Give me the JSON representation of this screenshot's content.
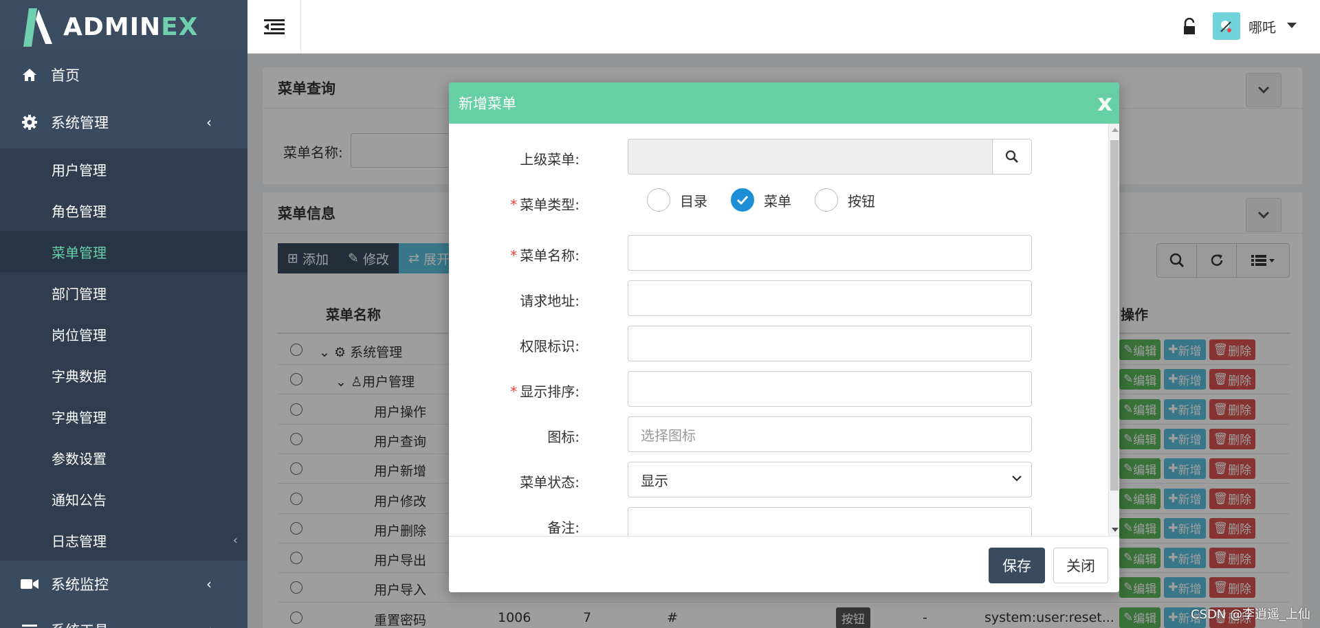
{
  "brand": {
    "logo_main": "ADMIN",
    "logo_accent": "EX"
  },
  "sidebar": {
    "items": [
      {
        "label": "首页",
        "icon": "home-icon"
      },
      {
        "label": "系统管理",
        "icon": "gear-icon"
      },
      {
        "label": "系统监控",
        "icon": "video-icon"
      },
      {
        "label": "系统工具",
        "icon": "bars-icon"
      }
    ],
    "sub_items": [
      "用户管理",
      "角色管理",
      "菜单管理",
      "部门管理",
      "岗位管理",
      "字典数据",
      "字典管理",
      "参数设置",
      "通知公告",
      "日志管理"
    ],
    "active_sub": "菜单管理"
  },
  "topbar": {
    "username": "哪吒"
  },
  "query_panel": {
    "title": "菜单查询",
    "search_label": "菜单名称:"
  },
  "info_panel": {
    "title": "菜单信息",
    "toolbar": {
      "add": "添加",
      "edit": "修改",
      "expand": "展开"
    },
    "columns": {
      "name": "菜单名称",
      "ops": "操作"
    },
    "rows": [
      {
        "name": "系统管理"
      },
      {
        "name": "用户管理"
      },
      {
        "name": "用户操作"
      },
      {
        "name": "用户查询"
      },
      {
        "name": "用户新增"
      },
      {
        "name": "用户修改"
      },
      {
        "name": "用户删除"
      },
      {
        "name": "用户导出"
      },
      {
        "name": "用户导入"
      },
      {
        "name": "重置密码",
        "id": "1006",
        "order": "7",
        "url": "#",
        "type": "按钮",
        "visible": "-",
        "perm": "system:user:reset..."
      }
    ],
    "op_labels": {
      "edit": "编辑",
      "add": "新增",
      "del": "删除"
    }
  },
  "modal": {
    "title": "新增菜单",
    "close_glyph": "x",
    "fields": {
      "parent_label": "上级菜单:",
      "type_label": "菜单类型:",
      "type_options": [
        "目录",
        "菜单",
        "按钮"
      ],
      "type_selected": "菜单",
      "name_label": "菜单名称:",
      "url_label": "请求地址:",
      "perm_label": "权限标识:",
      "order_label": "显示排序:",
      "icon_label": "图标:",
      "icon_placeholder": "选择图标",
      "status_label": "菜单状态:",
      "status_value": "显示",
      "remark_label": "备注:"
    },
    "buttons": {
      "save": "保存",
      "close": "关闭"
    }
  },
  "watermark": "CSDN @李逍遥_上仙",
  "colors": {
    "accent": "#67cfa5",
    "sidebar": "#3a4b5f",
    "check": "#1b8ed6"
  }
}
